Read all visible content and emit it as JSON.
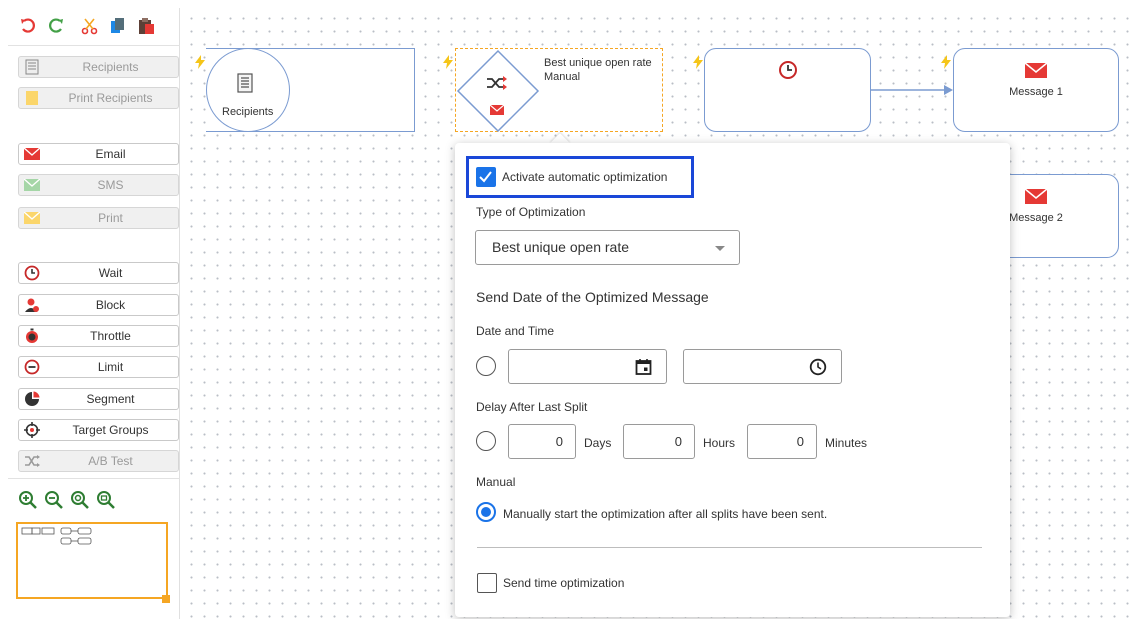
{
  "toolbar": {
    "undo_icon": "undo-icon",
    "redo_icon": "redo-icon",
    "cut_icon": "scissors-icon",
    "copy_icon": "copy-icon",
    "paste_icon": "paste-icon"
  },
  "sidebar": {
    "recipients": "Recipients",
    "print_recipients": "Print Recipients",
    "email": "Email",
    "sms": "SMS",
    "print": "Print",
    "wait": "Wait",
    "block": "Block",
    "throttle": "Throttle",
    "limit": "Limit",
    "segment": "Segment",
    "target_groups": "Target Groups",
    "ab_test": "A/B Test"
  },
  "canvas": {
    "recipients_node": "Recipients",
    "ab_node_line1": "Best unique open rate",
    "ab_node_line2": "Manual",
    "message1": "Message 1",
    "message2": "Message 2"
  },
  "popup": {
    "activate_label": "Activate automatic optimization",
    "activate_checked": true,
    "type_label": "Type of Optimization",
    "type_value": "Best unique open rate",
    "send_date_heading": "Send Date of the Optimized Message",
    "date_time_label": "Date and Time",
    "delay_label": "Delay After Last Split",
    "days_value": "0",
    "days_label": "Days",
    "hours_value": "0",
    "hours_label": "Hours",
    "minutes_value": "0",
    "minutes_label": "Minutes",
    "manual_label": "Manual",
    "manual_option": "Manually start the optimization after all splits have been sent.",
    "send_time_label": "Send time optimization"
  },
  "colors": {
    "accent_blue": "#1a73e8",
    "highlight_blue": "#1a47d8",
    "node_border": "#7b9bd1",
    "selection_orange": "#f5a623",
    "bolt_yellow": "#f5c518",
    "email_red": "#e53935"
  }
}
